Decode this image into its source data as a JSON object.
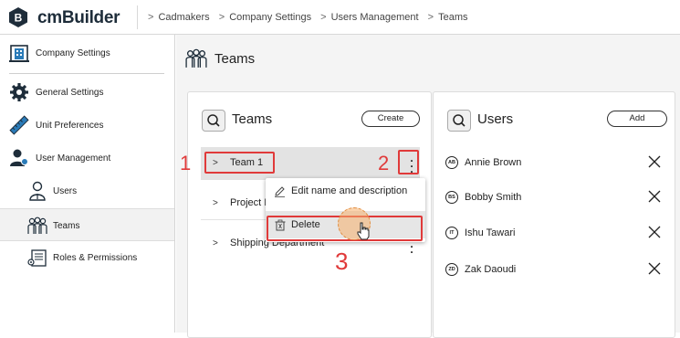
{
  "app": {
    "brand": "cmBuilder"
  },
  "breadcrumb": [
    "Cadmakers",
    "Company Settings",
    "Users Management",
    "Teams"
  ],
  "breadcrumb_separator": ">",
  "sidebar": {
    "header": {
      "label": "Company Settings",
      "icon": "building-icon"
    },
    "items": [
      {
        "label": "General Settings",
        "icon": "gear-icon"
      },
      {
        "label": "Unit Preferences",
        "icon": "ruler-icon"
      },
      {
        "label": "User Management",
        "icon": "user-gear-icon"
      },
      {
        "label": "Users",
        "icon": "user-icon"
      },
      {
        "label": "Teams",
        "icon": "team-icon",
        "active": true
      },
      {
        "label": "Roles & Permissions",
        "icon": "roles-icon"
      }
    ]
  },
  "page": {
    "title": "Teams",
    "icon": "team-icon"
  },
  "teams_panel": {
    "title": "Teams",
    "create_label": "Create",
    "teams": [
      {
        "name": "Team 1"
      },
      {
        "name": "Project I"
      },
      {
        "name": "Shipping Department"
      }
    ]
  },
  "users_panel": {
    "title": "Users",
    "add_label": "Add",
    "users": [
      {
        "initials": "AB",
        "name": "Annie Brown"
      },
      {
        "initials": "BS",
        "name": "Bobby Smith"
      },
      {
        "initials": "IT",
        "name": "Ishu Tawari"
      },
      {
        "initials": "ZD",
        "name": "Zak Daoudi"
      }
    ]
  },
  "context_menu": {
    "items": [
      {
        "label": "Edit name and description",
        "icon": "pencil-icon"
      },
      {
        "label": "Delete",
        "icon": "trash-icon"
      }
    ]
  },
  "annotations": {
    "step1": "1",
    "step2": "2",
    "step3": "3",
    "color": "#e03a3a"
  },
  "colors": {
    "accent_dark": "#1e2d3a",
    "highlight_red": "#e03a3a",
    "click_orange": "#f5af69"
  }
}
